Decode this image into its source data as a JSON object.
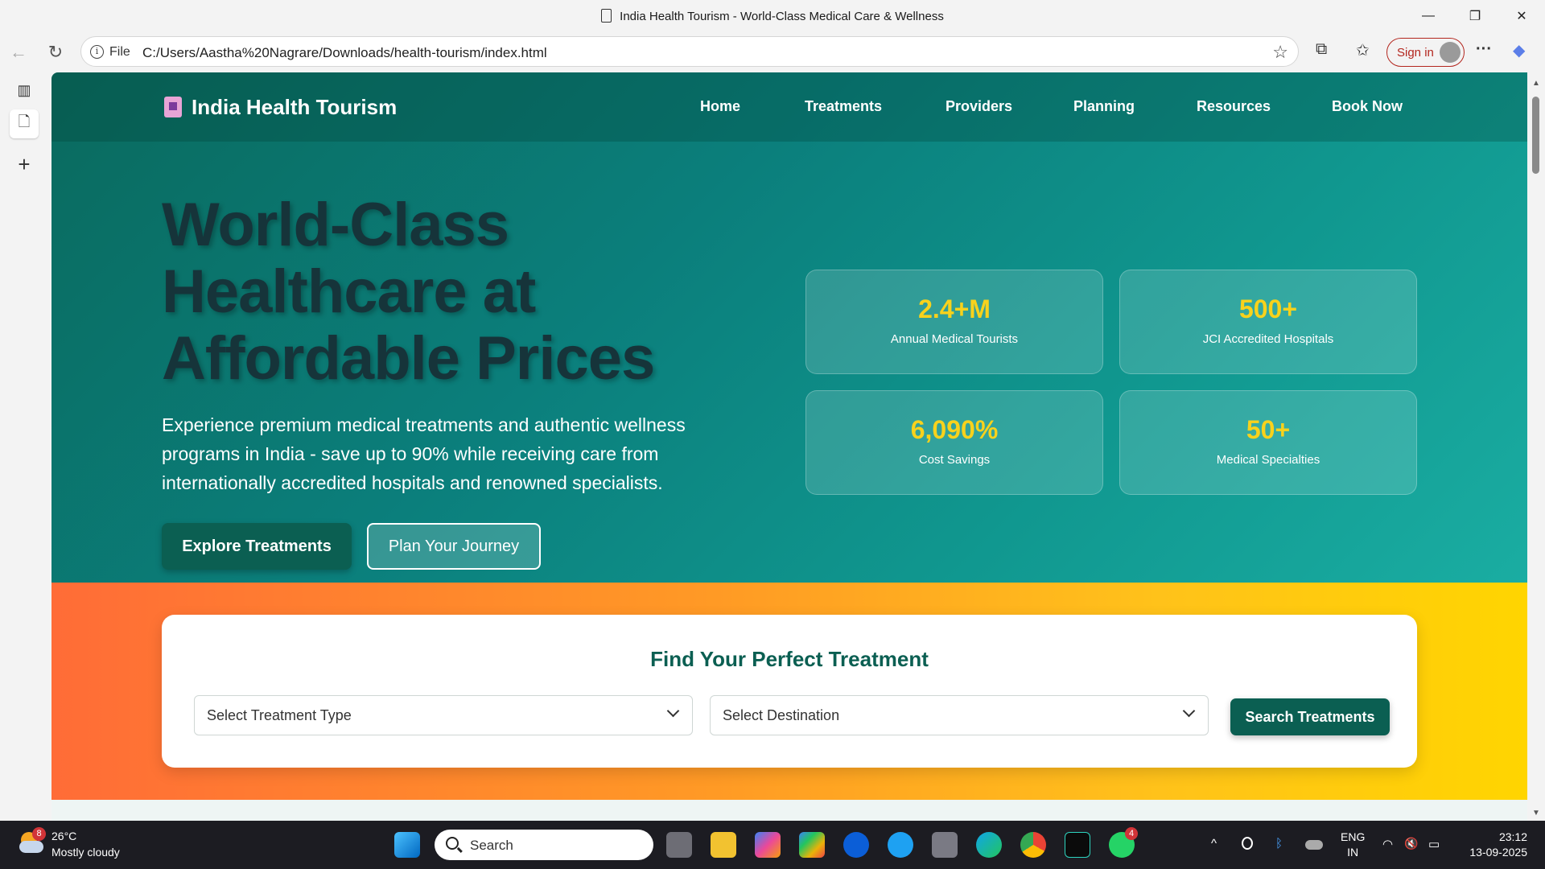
{
  "window": {
    "title": "India Health Tourism - World-Class Medical Care & Wellness",
    "minimize_glyph": "—",
    "restore_glyph": "❐",
    "close_glyph": "✕"
  },
  "browser": {
    "back_glyph": "←",
    "reload_glyph": "↻",
    "info_glyph": "i",
    "file_label": "File",
    "url": "C:/Users/Aastha%20Nagrare/Downloads/health-tourism/index.html",
    "favorite_glyph": "☆",
    "extensions_glyph": "⧉",
    "favorites_glyph": "✩",
    "sign_in_label": "Sign in",
    "more_glyph": "···",
    "copilot_glyph": "◆"
  },
  "vertical_tabs": {
    "panel_glyph": "▥",
    "tab_glyph": "🗋",
    "new_tab_glyph": "+"
  },
  "site": {
    "brand": "India Health Tourism",
    "nav": [
      "Home",
      "Treatments",
      "Providers",
      "Planning",
      "Resources",
      "Book Now"
    ],
    "hero": {
      "title": "World-Class Healthcare at Affordable Prices",
      "subtitle": "Experience premium medical treatments and authentic wellness programs in India - save up to 90% while receiving care from internationally accredited hospitals and renowned specialists.",
      "primary_button": "Explore Treatments",
      "secondary_button": "Plan Your Journey"
    },
    "stats": [
      {
        "value": "2.4+M",
        "label": "Annual Medical Tourists"
      },
      {
        "value": "500+",
        "label": "JCI Accredited Hospitals"
      },
      {
        "value": "6,090%",
        "label": "Cost Savings"
      },
      {
        "value": "50+",
        "label": "Medical Specialties"
      }
    ],
    "search": {
      "title": "Find Your Perfect Treatment",
      "treatment_select": "Select Treatment Type",
      "destination_select": "Select Destination",
      "button": "Search Treatments"
    }
  },
  "scrollbar": {
    "up_glyph": "▲",
    "down_glyph": "▼"
  },
  "taskbar": {
    "weather_badge": "8",
    "temperature": "26°C",
    "condition": "Mostly cloudy",
    "search_placeholder": "Search",
    "whatsapp_badge": "4",
    "language_top": "ENG",
    "language_bottom": "IN",
    "time": "23:12",
    "date": "13-09-2025",
    "tray_chevron_glyph": "^",
    "tray_wifi_glyph": "◠",
    "tray_volume_glyph": "🔇",
    "tray_battery_glyph": "▭"
  },
  "colors": {
    "brand_teal": "#0b5f52",
    "stat_yellow": "#f8d21c",
    "signin_red": "#b3261e"
  }
}
